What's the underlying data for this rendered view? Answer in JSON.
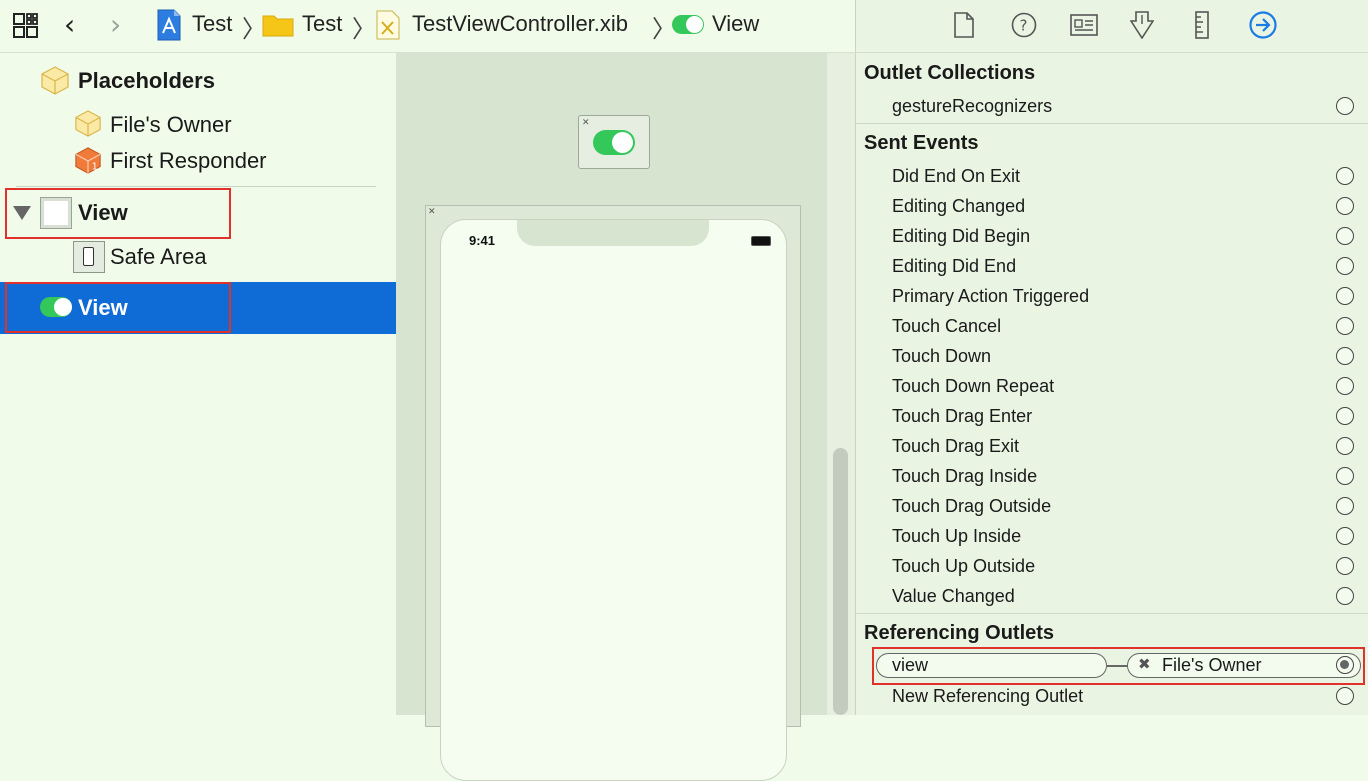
{
  "breadcrumb": {
    "items": [
      "Test",
      "Test",
      "TestViewController.xib",
      "View"
    ]
  },
  "outline": {
    "placeholders": "Placeholders",
    "files_owner": "File's Owner",
    "first_responder": "First Responder",
    "view": "View",
    "safe_area": "Safe Area",
    "switch_view": "View"
  },
  "canvas": {
    "status_time": "9:41"
  },
  "inspector": {
    "outlet_collections": {
      "title": "Outlet Collections",
      "items": [
        "gestureRecognizers"
      ]
    },
    "sent_events": {
      "title": "Sent Events",
      "items": [
        "Did End On Exit",
        "Editing Changed",
        "Editing Did Begin",
        "Editing Did End",
        "Primary Action Triggered",
        "Touch Cancel",
        "Touch Down",
        "Touch Down Repeat",
        "Touch Drag Enter",
        "Touch Drag Exit",
        "Touch Drag Inside",
        "Touch Drag Outside",
        "Touch Up Inside",
        "Touch Up Outside",
        "Value Changed"
      ]
    },
    "referencing_outlets": {
      "title": "Referencing Outlets",
      "outlet_name": "view",
      "target": "File's Owner",
      "new_outlet": "New Referencing Outlet"
    }
  },
  "colors": {
    "selection": "#0f6bd6",
    "accent": "#1a7ce5",
    "switch_green": "#34c759",
    "highlight_red": "#e0312b"
  }
}
